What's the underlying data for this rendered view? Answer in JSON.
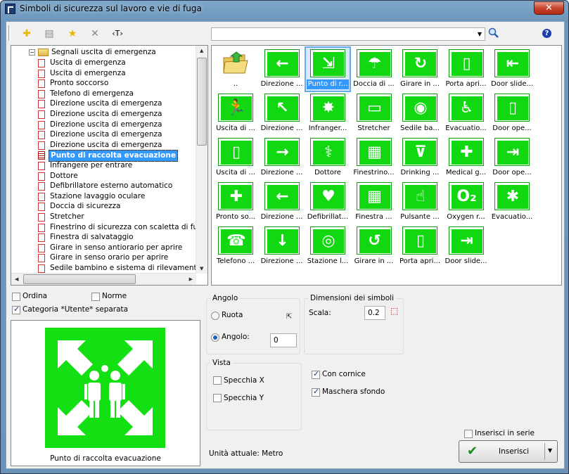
{
  "window": {
    "title": "Simboli di sicurezza sul lavoro e vie di fuga",
    "close": "✕"
  },
  "toolbar": {
    "icons": [
      "add-icon",
      "list-icon",
      "favorite-star-icon",
      "delete-icon",
      "text-tag-icon"
    ],
    "text_tag": "‹T›",
    "help": "?"
  },
  "search": {
    "value": "",
    "dropdown": "▼"
  },
  "tree": {
    "header": "Segnali uscita di emergenza",
    "items": [
      "Uscita di emergenza",
      "Uscita di emergenza",
      "Pronto soccorso",
      "Telefono di emergenza",
      "Direzione uscita di emergenza",
      "Direzione uscita di emergenza",
      "Direzione uscita di emergenza",
      "Direzione uscita di emergenza",
      "Direzione uscita di emergenza",
      "Punto di raccolta evacuazione",
      "Infrangere per entrare",
      "Dottore",
      "Defibrillatore esterno automatico",
      "Stazione lavaggio oculare",
      "Doccia di sicurezza",
      "Stretcher",
      "Finestrino di sicurezza con scaletta di fuga",
      "Finestra di salvataggio",
      "Girare in senso antiorario per aprire",
      "Girare in senso orario per aprire",
      "Sedile bambino e sistema di rilevamento pr"
    ],
    "selected_index": 9
  },
  "grid": {
    "rows": [
      [
        {
          "l": "..",
          "g": "folder"
        },
        {
          "l": "Direzione ...",
          "g": "←"
        },
        {
          "l": "Punto di r...",
          "g": "⇲"
        },
        {
          "l": "Doccia di ...",
          "g": "☂"
        },
        {
          "l": "Girare in ...",
          "g": "↻"
        },
        {
          "l": "Porta apri...",
          "g": "▯"
        },
        {
          "l": "Door slide...",
          "g": "⇤"
        }
      ],
      [
        {
          "l": "Uscita di ...",
          "g": "🏃"
        },
        {
          "l": "Direzione ...",
          "g": "↖"
        },
        {
          "l": "Infranger...",
          "g": "✸"
        },
        {
          "l": "Stretcher",
          "g": "▭"
        },
        {
          "l": "Sedile ba...",
          "g": "◉"
        },
        {
          "l": "Evacuatio...",
          "g": "♿"
        },
        {
          "l": "Door ope...",
          "g": "▯"
        }
      ],
      [
        {
          "l": "Uscita di ...",
          "g": "▯"
        },
        {
          "l": "Direzione ...",
          "g": "→"
        },
        {
          "l": "Dottore",
          "g": "⚕"
        },
        {
          "l": "Finestrino...",
          "g": "▦"
        },
        {
          "l": "Drinking ...",
          "g": "⊽"
        },
        {
          "l": "Medical g...",
          "g": "✚"
        },
        {
          "l": "Door ope...",
          "g": "⇥"
        }
      ],
      [
        {
          "l": "Pronto so...",
          "g": "✚"
        },
        {
          "l": "Direzione ...",
          "g": "←"
        },
        {
          "l": "Defibrillat...",
          "g": "♥"
        },
        {
          "l": "Finestra ...",
          "g": "▦"
        },
        {
          "l": "Pulsante ...",
          "g": "☝"
        },
        {
          "l": "Oxygen r...",
          "g": "O₂"
        },
        {
          "l": "Evacuatio...",
          "g": "✱"
        }
      ],
      [
        {
          "l": "Telefono ...",
          "g": "☎"
        },
        {
          "l": "Direzione ...",
          "g": "↓"
        },
        {
          "l": "Stazione l...",
          "g": "◎"
        },
        {
          "l": "Girare in ...",
          "g": "↺"
        },
        {
          "l": "Porta apri...",
          "g": "▯"
        },
        {
          "l": "Door slide...",
          "g": "⇥"
        }
      ]
    ],
    "selected": "0-2"
  },
  "options": {
    "ordina": "Ordina",
    "norme": "Norme",
    "categoria": "Categoria *Utente* separata"
  },
  "angolo": {
    "caption": "Angolo",
    "ruota": "Ruota",
    "angolo": "Angolo:",
    "value": "0"
  },
  "dimensioni": {
    "caption": "Dimensioni dei simboli",
    "scala": "Scala:",
    "value": "0.2"
  },
  "vista": {
    "caption": "Vista",
    "specchia_x": "Specchia X",
    "specchia_y": "Specchia Y"
  },
  "flags": {
    "con_cornice": "Con cornice",
    "maschera": "Maschera sfondo",
    "inserisci_serie": "Inserisci in serie"
  },
  "preview": {
    "caption": "Punto di raccolta evacuazione"
  },
  "status": {
    "unita": "Unità attuale: Metro"
  },
  "insert": {
    "label": "Inserisci",
    "dropdown": "▼"
  },
  "colors": {
    "sign_green": "#13e013",
    "selection": "#3399ff"
  }
}
